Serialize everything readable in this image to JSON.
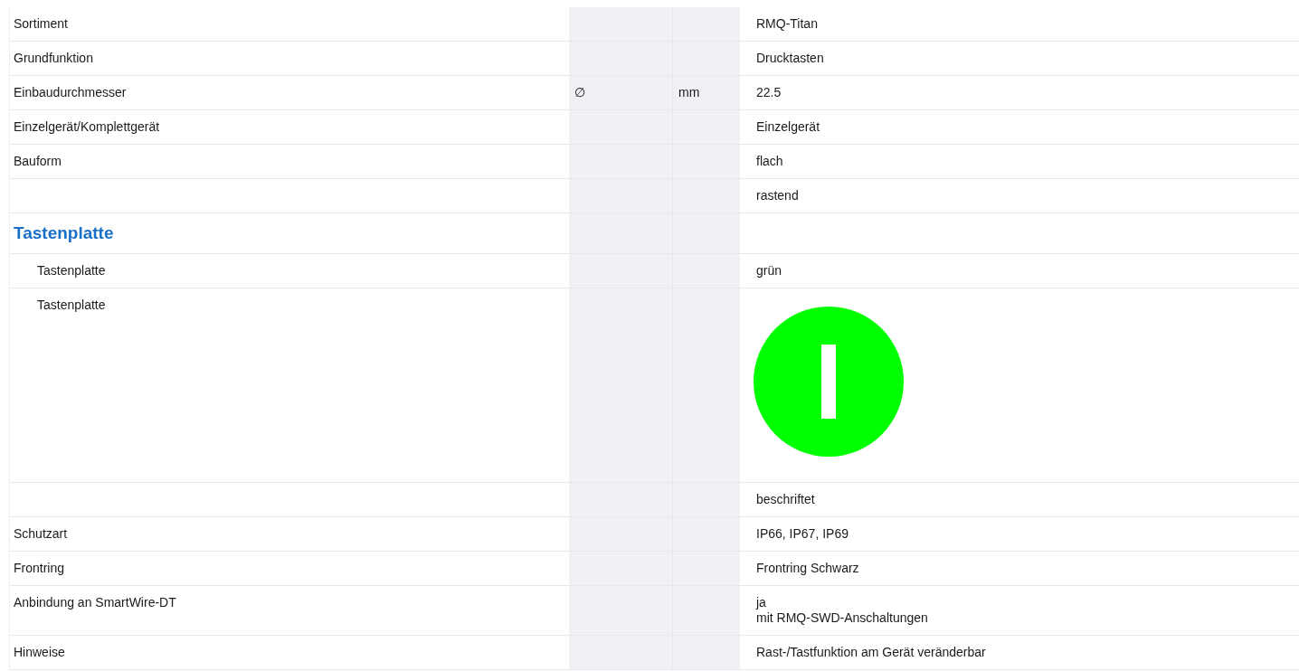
{
  "rows": [
    {
      "kind": "row",
      "label": "Sortiment",
      "value": "RMQ-Titan"
    },
    {
      "kind": "row",
      "label": "Grundfunktion",
      "value": "Drucktasten"
    },
    {
      "kind": "row",
      "label": "Einbaudurchmesser",
      "symbol": "∅",
      "unit": "mm",
      "value": "22.5"
    },
    {
      "kind": "row",
      "label": "Einzelgerät/Komplettgerät",
      "value": "Einzelgerät"
    },
    {
      "kind": "row",
      "label": "Bauform",
      "value": "flach"
    },
    {
      "kind": "row",
      "value": "rastend"
    },
    {
      "kind": "heading",
      "label": "Tastenplatte",
      "children": [
        {
          "kind": "row",
          "label": "Tastenplatte",
          "value": "grün"
        },
        {
          "kind": "image",
          "label": "Tastenplatte"
        }
      ]
    },
    {
      "kind": "row",
      "value": "beschriftet"
    },
    {
      "kind": "row",
      "label": "Schutzart",
      "value": "IP66, IP67, IP69"
    },
    {
      "kind": "row",
      "label": "Frontring",
      "value": "Frontring Schwarz"
    },
    {
      "kind": "row",
      "label": "Anbindung an SmartWire-DT",
      "value": "ja\nmit RMQ-SWD-Anschaltungen"
    },
    {
      "kind": "row",
      "label": "Hinweise",
      "value": "Rast-/Tastfunktion am Gerät veränderbar"
    }
  ]
}
